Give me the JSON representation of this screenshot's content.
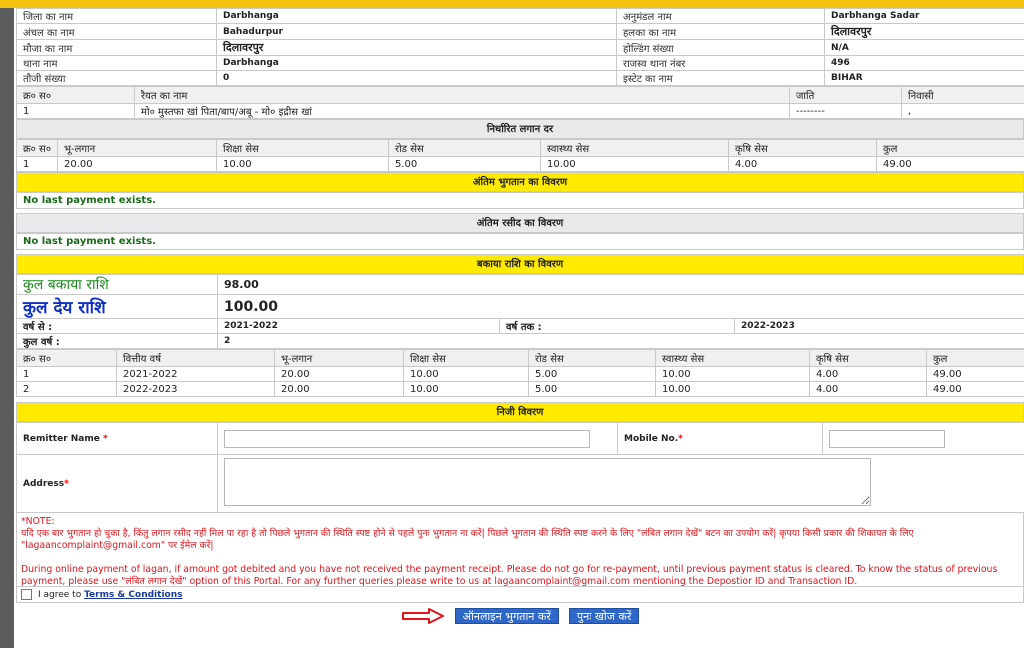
{
  "info": [
    {
      "l1": "जिला का नाम",
      "v1": "Darbhanga",
      "l2": "अनुमंडल नाम",
      "v2": "Darbhanga Sadar"
    },
    {
      "l1": "अंचल का नाम",
      "v1": "Bahadurpur",
      "l2": "हलका का नाम",
      "v2": "दिलावरपुर"
    },
    {
      "l1": "मौजा का नाम",
      "v1": "दिलावरपुर",
      "l2": "होल्डिंग संख्या",
      "v2": "N/A"
    },
    {
      "l1": "थाना नाम",
      "v1": "Darbhanga",
      "l2": "राजस्व थाना नंबर",
      "v2": "496"
    },
    {
      "l1": "तौजी संख्या",
      "v1": "0",
      "l2": "इस्टेट का नाम",
      "v2": "BIHAR"
    }
  ],
  "raiyat": {
    "headers": {
      "sn": "क्र० स०",
      "name": "रैयत का नाम",
      "caste": "जाति",
      "resident": "निवासी"
    },
    "row": {
      "sn": "1",
      "name": "मो० मुस्तफा खां पिता/बाप/अबू - मो० इद्रीस खां",
      "caste": "--------",
      "resident": ","
    }
  },
  "rate": {
    "title": "निर्धारित लगान दर",
    "headers": [
      "क्र० स०",
      "भू-लगान",
      "शिक्षा सेस",
      "रोड सेस",
      "स्वास्थ्य सेस",
      "कृषि सेस",
      "कुल"
    ],
    "row": [
      "1",
      "20.00",
      "10.00",
      "5.00",
      "10.00",
      "4.00",
      "49.00"
    ]
  },
  "last_payment": {
    "title": "अंतिम भुगतान का विवरण",
    "message": "No last payment exists."
  },
  "last_receipt": {
    "title": "अंतिम रसीद का विवरण",
    "message": "No last payment exists."
  },
  "dues": {
    "title": "बकाया राशि का विवरण",
    "total_due_label": "कुल बकाया राशि",
    "total_due": "98.00",
    "payable_label": "कुल देय राशि",
    "payable": "100.00",
    "year_from_label": "वर्ष से :",
    "year_from": "2021-2022",
    "year_to_label": "वर्ष तक :",
    "year_to": "2022-2023",
    "total_years_label": "कुल वर्ष :",
    "total_years": "2",
    "headers": [
      "क्र० स०",
      "वित्तीय वर्ष",
      "भू-लगान",
      "शिक्षा सेस",
      "रोड सेस",
      "स्वास्थ्य सेस",
      "कृषि सेस",
      "कुल"
    ],
    "rows": [
      [
        "1",
        "2021-2022",
        "20.00",
        "10.00",
        "5.00",
        "10.00",
        "4.00",
        "49.00"
      ],
      [
        "2",
        "2022-2023",
        "20.00",
        "10.00",
        "5.00",
        "10.00",
        "4.00",
        "49.00"
      ]
    ]
  },
  "personal": {
    "title": "निजी विवरण",
    "remitter_label": "Remitter Name ",
    "remitter_value": "",
    "mobile_label": "Mobile No.",
    "mobile_value": "",
    "address_label": "Address",
    "address_value": "",
    "required_mark": "*"
  },
  "note": {
    "heading": "*NOTE:",
    "hindi": "यदि एक बार भुगतान हो चुका है, किंतु लगान रसीद नहीं मिल पा रहा है तो पिछले भुगतान की स्थिति स्पष्ट होने से पहले पुनः भुगतान ना करें| पिछले भुगतान की स्थिति स्पष्ट करने के लिए \"लंबित लगान देखें\" बटन का उपयोग करें| कृपया किसी प्रकार की शिकायत के लिए \"lagaancomplaint@gmail.com\" पर ईमेल करें|",
    "english": "During online payment of lagan, if amount got debited and you have not received the payment receipt. Please do not go for re-payment, until previous payment status is cleared. To know the status of previous payment, please use \"लंबित लगान देखें\" option of this Portal. For any further queries please write to us at lagaancomplaint@gmail.com mentioning the Depostior ID and Transaction ID."
  },
  "agree": {
    "prefix": "I agree to ",
    "link": "Terms & Conditions"
  },
  "buttons": {
    "pay": "ऑनलाइन भुगतान करें",
    "search": "पुनः खोज करें"
  },
  "colors": {
    "section_yellow": "#ffea00",
    "button_blue": "#2f67c9",
    "arrow_red": "#e0141c",
    "note_red": "#e0141c"
  }
}
